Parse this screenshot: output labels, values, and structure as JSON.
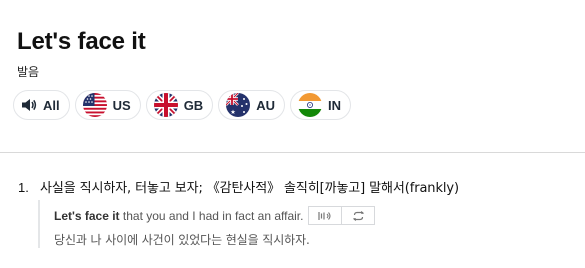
{
  "entry": {
    "title": "Let's face it",
    "pronunciation_label": "발음"
  },
  "accents": [
    {
      "label": "All",
      "icon": "speaker-icon"
    },
    {
      "label": "US",
      "icon": "us-flag-icon"
    },
    {
      "label": "GB",
      "icon": "gb-flag-icon"
    },
    {
      "label": "AU",
      "icon": "au-flag-icon"
    },
    {
      "label": "IN",
      "icon": "in-flag-icon"
    }
  ],
  "definitions": [
    {
      "number": "1.",
      "text": "사실을 직시하자, 터놓고 보자; 《감탄사적》 솔직히[까놓고] 말해서(frankly)",
      "example": {
        "phrase": "Let's face it",
        "rest": " that you and I had in fact an affair.",
        "translation": "당신과 나 사이에 사건이 있었다는 현실을 직시하자.",
        "buttons": [
          "listen-icon",
          "repeat-icon"
        ]
      }
    }
  ],
  "colors": {
    "title": "#111111",
    "chip_border": "#e3e5e8",
    "chip_text": "#1f2a37",
    "divider": "#d9d9d9",
    "example_text": "#555555"
  }
}
